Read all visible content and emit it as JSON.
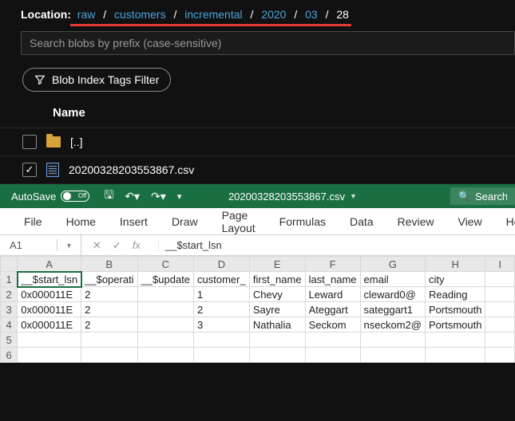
{
  "storage": {
    "location_label": "Location:",
    "breadcrumb": [
      "raw",
      "customers",
      "incremental",
      "2020",
      "03",
      "28"
    ],
    "search_placeholder": "Search blobs by prefix (case-sensitive)",
    "tags_filter_label": "Blob Index Tags Filter",
    "column_header": "Name",
    "up_dir": "[..]",
    "file_name": "20200328203553867.csv"
  },
  "excel": {
    "autosave_label": "AutoSave",
    "autosave_state": "Off",
    "file_title": "20200328203553867.csv",
    "search_placeholder": "Search",
    "tabs": [
      "File",
      "Home",
      "Insert",
      "Draw",
      "Page Layout",
      "Formulas",
      "Data",
      "Review",
      "View",
      "He"
    ],
    "namebox": "A1",
    "fx_label": "fx",
    "formula_value": "__$start_lsn",
    "columns": [
      "A",
      "B",
      "C",
      "D",
      "E",
      "F",
      "G",
      "H",
      "I"
    ],
    "row_numbers": [
      "1",
      "2",
      "3",
      "4",
      "5",
      "6"
    ],
    "header_row": [
      "__$start_lsn",
      "__$operati",
      "__$update",
      "customer_",
      "first_name",
      "last_name",
      "email",
      "city",
      ""
    ],
    "data_rows": [
      [
        "0x000011E",
        "2",
        "",
        "1",
        "Chevy",
        "Leward",
        "cleward0@",
        "Reading",
        ""
      ],
      [
        "0x000011E",
        "2",
        "",
        "2",
        "Sayre",
        "Ateggart",
        "sateggart1",
        "Portsmouth",
        ""
      ],
      [
        "0x000011E",
        "2",
        "",
        "3",
        "Nathalia",
        "Seckom",
        "nseckom2@",
        "Portsmouth",
        ""
      ]
    ]
  }
}
